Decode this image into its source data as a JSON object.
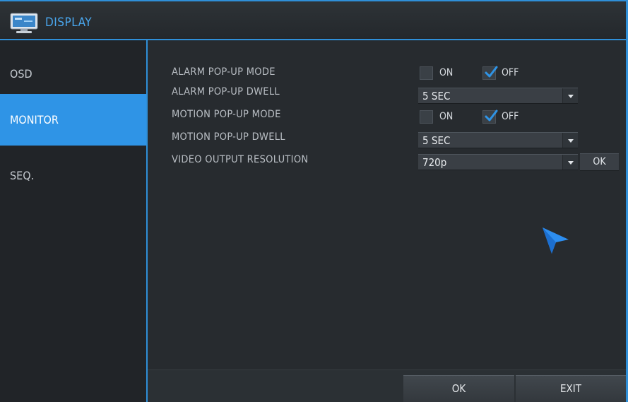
{
  "window": {
    "title": "DISPLAY",
    "title_icon": "monitor-icon"
  },
  "sidebar": {
    "items": [
      {
        "label": "OSD",
        "active": false
      },
      {
        "label": "MONITOR",
        "active": true
      },
      {
        "label": "SEQ.",
        "active": false
      }
    ]
  },
  "settings": {
    "alarm_popup_mode": {
      "label": "ALARM POP-UP MODE",
      "on_label": "ON",
      "off_label": "OFF",
      "on_checked": false,
      "off_checked": true
    },
    "alarm_popup_dwell": {
      "label": "ALARM POP-UP DWELL",
      "value": "5 SEC"
    },
    "motion_popup_mode": {
      "label": "MOTION POP-UP MODE",
      "on_label": "ON",
      "off_label": "OFF",
      "on_checked": false,
      "off_checked": true
    },
    "motion_popup_dwell": {
      "label": "MOTION POP-UP DWELL",
      "value": "5 SEC"
    },
    "video_output_resolution": {
      "label": "VIDEO OUTPUT RESOLUTION",
      "value": "720p",
      "apply_label": "OK"
    }
  },
  "footer": {
    "ok_label": "OK",
    "exit_label": "EXIT"
  },
  "colors": {
    "accent": "#2f94e6",
    "title_text": "#4aa8f0",
    "background": "#272b2f"
  }
}
